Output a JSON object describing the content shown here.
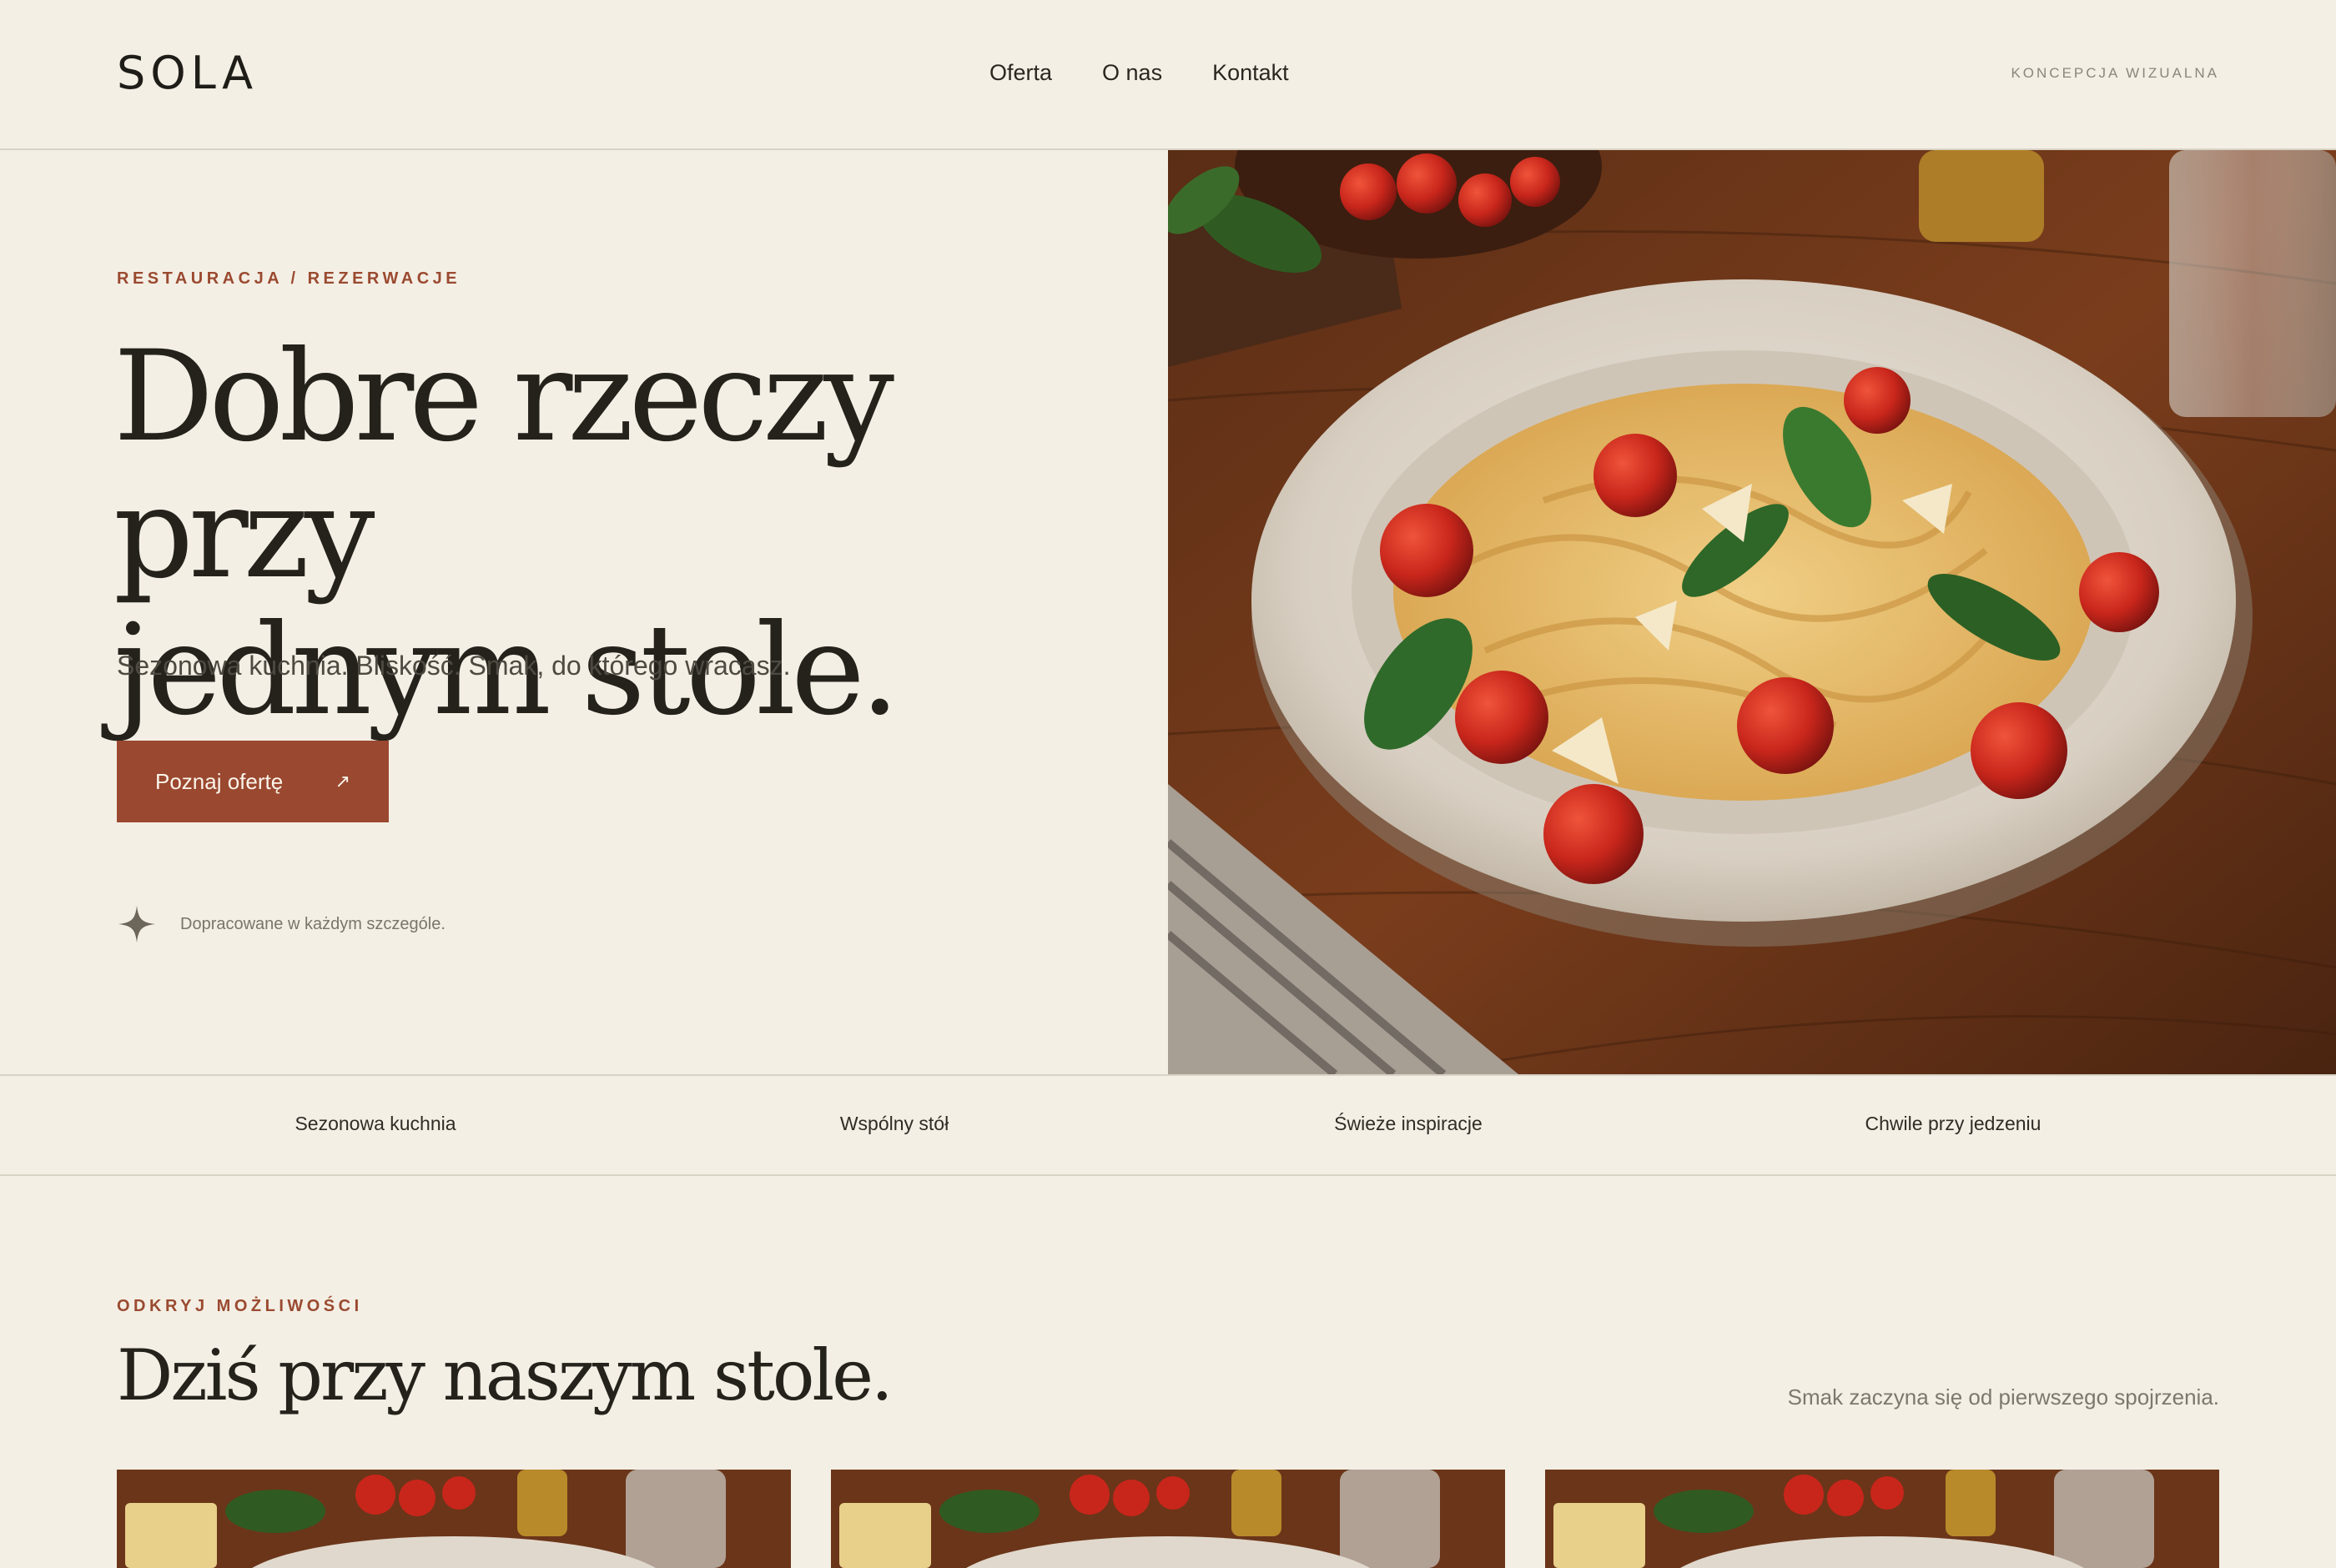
{
  "header": {
    "logo": "SOLA",
    "nav": [
      "Oferta",
      "O nas",
      "Kontakt"
    ],
    "concept_label": "KONCEPCJA WIZUALNA"
  },
  "hero": {
    "kicker": "RESTAURACJA / REZERWACJE",
    "title_line1": "Dobre rzeczy przy",
    "title_line2": "jednym stole.",
    "subtitle": "Sezonowa kuchnia. Bliskość. Smak, do którego wracasz.",
    "cta_label": "Poznaj ofertę",
    "cta_icon": "↗",
    "detail_text": "Dopracowane w każdym szczególe.",
    "detail_icon": "sparkle-star-icon",
    "image": "pasta-with-roasted-tomatoes-and-basil-photo"
  },
  "features": [
    "Sezonowa kuchnia",
    "Wspólny stół",
    "Świeże inspiracje",
    "Chwile przy jedzeniu"
  ],
  "section": {
    "kicker": "ODKRYJ MOŻLIWOŚCI",
    "title": "Dziś przy naszym stole.",
    "aside": "Smak zaczyna się od pierwszego spojrzenia."
  },
  "cards": [
    {
      "image": "pasta-dish-photo"
    },
    {
      "image": "pasta-dish-photo"
    },
    {
      "image": "pasta-dish-photo"
    }
  ],
  "colors": {
    "background": "#f4efe5",
    "accent": "#9a4830",
    "text": "#24221b",
    "divider": "#d8d2c6"
  }
}
